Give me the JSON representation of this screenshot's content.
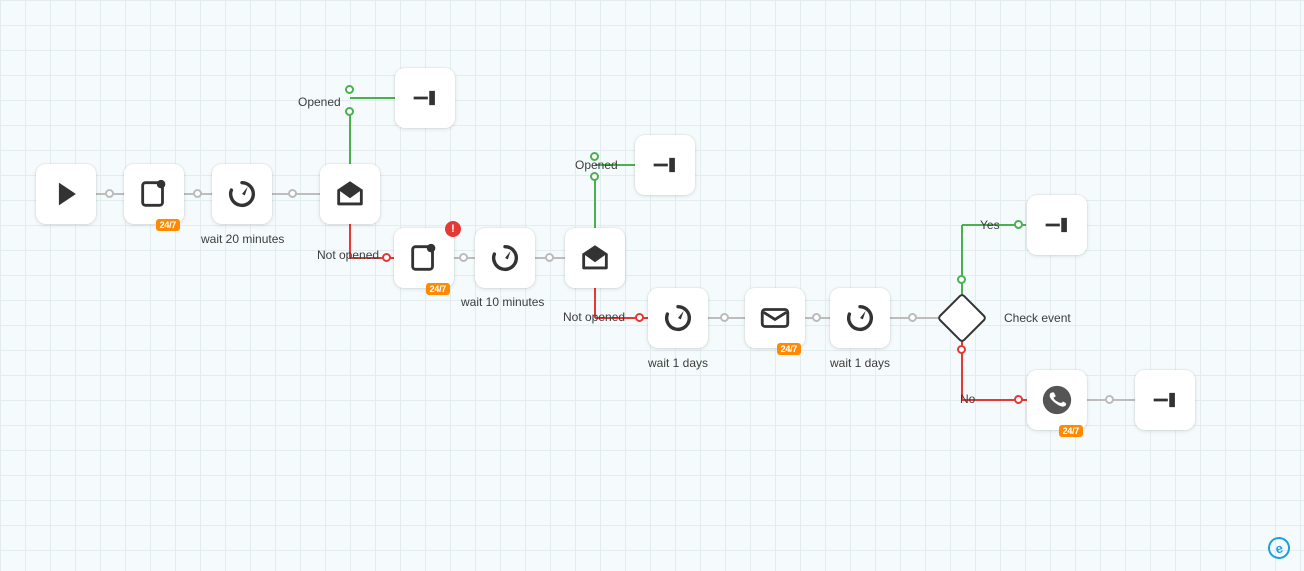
{
  "labels": {
    "opened1": "Opened",
    "notopened1": "Not opened",
    "wait20": "wait 20 minutes",
    "opened2": "Opened",
    "notopened2": "Not opened",
    "wait10": "wait 10 minutes",
    "wait1a": "wait 1 days",
    "wait1b": "wait 1 days",
    "checkevent": "Check event",
    "yes": "Yes",
    "no": "No"
  },
  "badges": {
    "b247_1": "24/7",
    "b247_2": "24/7",
    "b247_3": "24/7",
    "b247_4": "24/7"
  },
  "icons": {
    "alert": "!"
  },
  "brand": "e"
}
